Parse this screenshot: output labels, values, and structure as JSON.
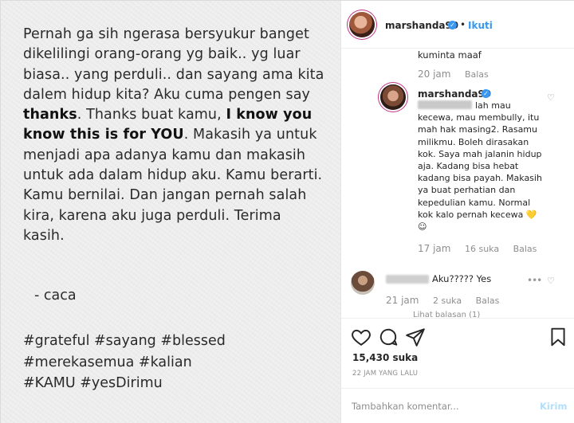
{
  "post_image": {
    "line1": "Pernah ga sih ngerasa bersyukur banget dikelilingi orang-orang yg baik.. yg luar biasa.. yang perduli.. dan sayang ama kita dalem hidup kita? Aku cuma pengen say ",
    "bold1": "thanks",
    "line2": ". Thanks buat kamu, ",
    "bold2": "I know you know this is for YOU",
    "line3": ". Makasih ya untuk menjadi apa adanya kamu dan makasih untuk ada dalam hidup aku. Kamu berarti. Kamu bernilai. Dan jangan pernah salah kira, karena aku juga perduli. Terima kasih.",
    "signature": "-   caca",
    "hashtags_line1": "#grateful #sayang #blessed",
    "hashtags_line2": "#merekasemua #kalian",
    "hashtags_line3": "#KAMU #yesDirimu"
  },
  "header": {
    "username": "marshanda99",
    "verified_mark": "✓",
    "separator": "•",
    "follow_label": "Ikuti"
  },
  "comments": {
    "cut_text": "kuminta maaf",
    "prev_meta": {
      "time": "20 jam",
      "reply": "Balas"
    },
    "reply": {
      "username": "marshanda99",
      "verified_mark": "✓",
      "body": "lah mau kecewa, mau membully, itu mah hak masing2. Rasamu milikmu. Boleh dirasakan kok. Saya mah jalanin hidup aja. Kadang bisa hebat kadang bisa payah. Makasih ya buat perhatian dan kepedulian kamu. Normal kok kalo pernah kecewa 💛 ☺",
      "time": "17 jam",
      "likes": "16 suka",
      "reply_label": "Balas"
    },
    "second": {
      "text": "Aku????? Yes",
      "time": "21 jam",
      "likes": "2 suka",
      "reply_label": "Balas",
      "view_replies": "Lihat balasan (1)"
    }
  },
  "actions": {
    "likes_count": "15,430 suka",
    "posted_ago": "22 JAM YANG LALU"
  },
  "add_comment": {
    "placeholder": "Tambahkan komentar...",
    "post_label": "Kirim"
  },
  "colors": {
    "accent": "#3897f0",
    "muted": "#8e8e8e",
    "story_ring": "#c13584"
  }
}
